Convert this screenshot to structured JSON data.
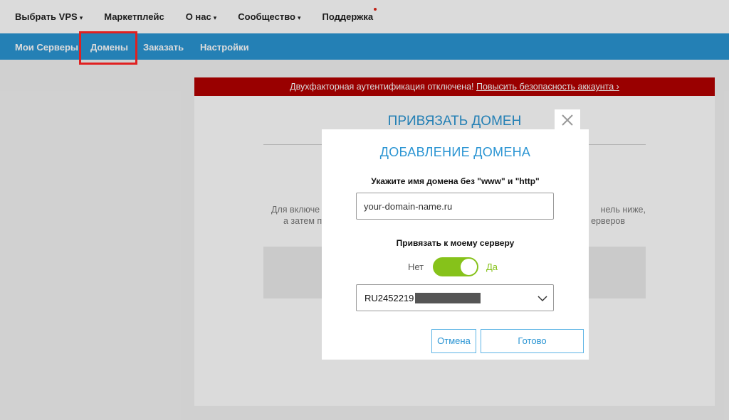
{
  "topnav": {
    "items": [
      {
        "label": "Выбрать VPS",
        "caret": "▾"
      },
      {
        "label": "Маркетплейс"
      },
      {
        "label": "О нас",
        "caret": "▾"
      },
      {
        "label": "Сообщество",
        "caret": "▾"
      },
      {
        "label": "Поддержка",
        "notification_dot": true
      }
    ]
  },
  "subnav": {
    "items": [
      "Мои Серверы",
      "Домены",
      "Заказать",
      "Настройки"
    ],
    "highlighted": "Домены"
  },
  "alert": {
    "text": "Двухфакторная аутентификация отключена! ",
    "link": "Повысить безопасность аккаунта ›"
  },
  "panel": {
    "title": "ПРИВЯЗАТЬ ДОМЕН",
    "text_left_1": "Для включе",
    "text_left_2": "а затем п",
    "text_right_1": "нель ниже,",
    "text_right_2": "ерверов"
  },
  "modal": {
    "title": "ДОБАВЛЕНИЕ ДОМЕНА",
    "domain_label": "Укажите имя домена без \"www\" и \"http\"",
    "domain_value": "your-domain-name.ru",
    "bind_label": "Привязать к моему серверу",
    "toggle_off_label": "Нет",
    "toggle_on_label": "Да",
    "toggle_state": true,
    "server_value": "RU2452219",
    "cancel_label": "Отмена",
    "ok_label": "Готово"
  },
  "colors": {
    "accent": "#2b95d3",
    "toggle_on": "#86c21a",
    "alert": "#b30000",
    "highlight": "#e02020"
  },
  "icons": {
    "close": "close-icon",
    "dropdown": "chevron-down-icon"
  }
}
